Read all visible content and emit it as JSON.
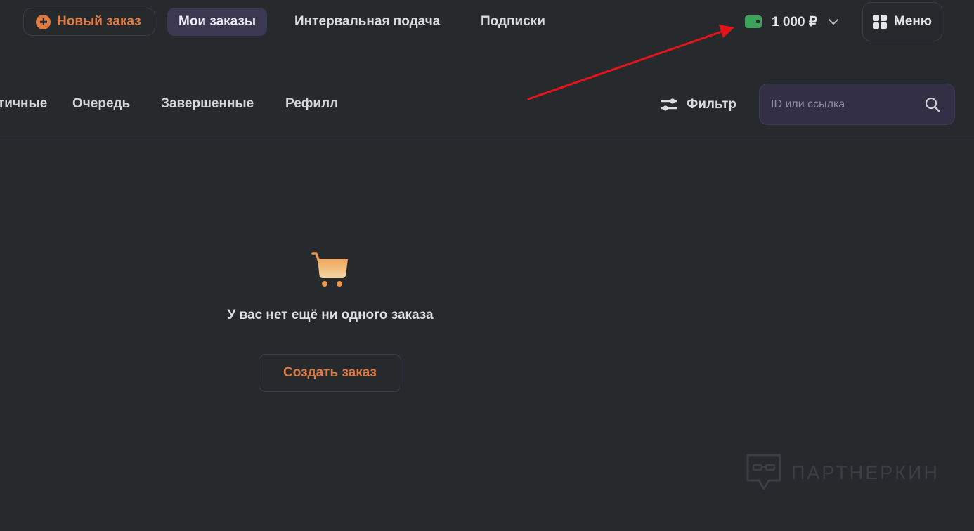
{
  "header": {
    "new_order_label": "Новый заказ",
    "tabs": [
      {
        "label": "Мои заказы",
        "active": true
      },
      {
        "label": "Интервальная подача",
        "active": false
      },
      {
        "label": "Подписки",
        "active": false
      }
    ],
    "balance": "1 000 ₽",
    "menu_label": "Меню"
  },
  "orders_nav": {
    "tabs": [
      {
        "label": "тичные"
      },
      {
        "label": "Очередь"
      },
      {
        "label": "Завершенные"
      },
      {
        "label": "Рефилл"
      }
    ],
    "filter_label": "Фильтр",
    "search": {
      "placeholder": "ID или ссылка",
      "value": ""
    }
  },
  "empty_state": {
    "message": "У вас нет ещё ни одного заказа",
    "create_label": "Создать заказ"
  },
  "watermark": {
    "text": "ПАРТНЕРКИН"
  },
  "colors": {
    "background": "#272a2d",
    "accent_orange": "#e07a43",
    "active_tab_bg": "#3d3852",
    "wallet_green": "#3ea25a",
    "annotation_arrow": "#e5141b"
  },
  "icons": [
    "plus-circle-icon",
    "wallet-icon",
    "chevron-down-icon",
    "grid-icon",
    "sliders-icon",
    "search-icon",
    "cart-icon",
    "logo-icon"
  ]
}
